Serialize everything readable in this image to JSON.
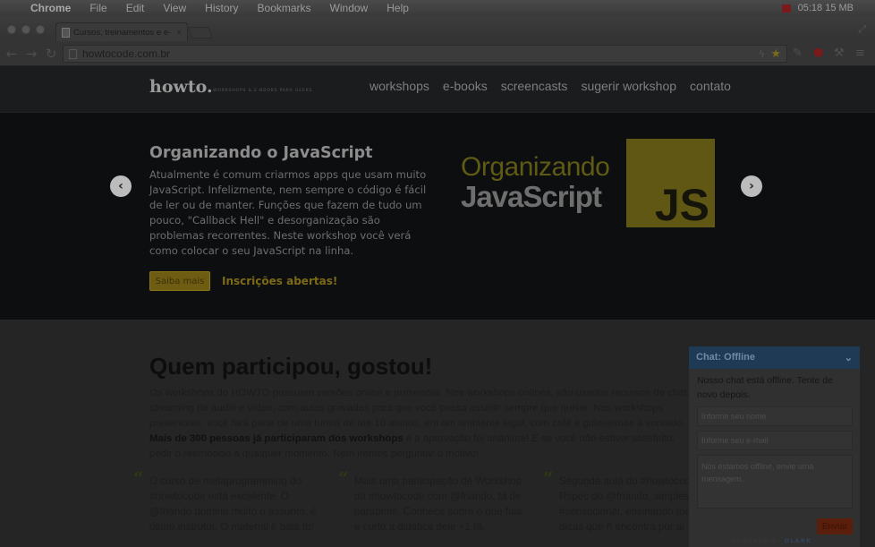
{
  "menubar": {
    "app": "Chrome",
    "items": [
      "File",
      "Edit",
      "View",
      "History",
      "Bookmarks",
      "Window",
      "Help"
    ],
    "status": "05:18  15 MB"
  },
  "browser": {
    "tab_title": "Cursos, treinamentos e e-",
    "tab_close": "×",
    "url": "howtocode.com.br"
  },
  "site": {
    "logo": "howto.",
    "tagline": "WORKSHOPS & E-BOOKS PARA GEEKS",
    "nav": [
      "workshops",
      "e-books",
      "screencasts",
      "sugerir workshop",
      "contato"
    ]
  },
  "hero": {
    "title": "Organizando o JavaScript",
    "description": "Atualmente é comum criarmos apps que usam muito JavaScript. Infelizmente, nem sempre o código é fácil de ler ou de manter. Funções que fazem de tudo um pouco, \"Callback Hell\" e desorganização são problemas recorrentes. Neste workshop você verá como colocar o seu JavaScript na linha.",
    "button": "Saiba mais",
    "status": "Inscrições abertas!",
    "image_line1": "Organizando",
    "image_line2": "JavaScript",
    "image_logo": "JS",
    "prev": "‹",
    "next": "›"
  },
  "section": {
    "title": "Quem participou, gostou!",
    "text_a": "Os workshops do HOWTO possuem versões online e presencial. Nos workshops onlines, são usados recursos de chat, streaming de áudio e vídeo, com aulas gravadas para que você possa assistir sempre que quiser. Nos workshops presenciais, você fará parte de uma turma de até 10 alunos, em um ambiente legal, com café e guloseimas à vontade. ",
    "text_bold": "Mais de 300 pessoas já participaram dos workshops",
    "text_b": " e a aprovação foi unânime! E se você não estiver satisfeito, pedir o reembolso a qualquer momento. Nem iremos perguntar o motivo!"
  },
  "testimonials": [
    "O curso de metaprogramming do #howtocode está excelente. O @fnando domina muito o assunto, é ótimo instrutor. O material é bala tb!",
    "Mais uma participação de Workshop da #howtocode com @fnando, tá de parabéns. Conhece sobre o que fala e curto a didática dele +1 fã.",
    "Segunda aula do #howtocode sobre Rspec do @fnando, simplesmente #sensacional, ensinando todas as dicas que ñ encontra por aí :)"
  ],
  "chat": {
    "header": "Chat: Offline",
    "message": "Nosso chat está offline. Tente de novo depois.",
    "name_placeholder": "Informe seu nome",
    "email_placeholder": "Informe seu e-mail",
    "message_placeholder": "Nós estamos offline, envie uma mensagem.",
    "send": "Enviar",
    "powered_prefix": "POWERED BY ",
    "powered_brand": "OLARK"
  },
  "colors": {
    "accent_yellow": "#c9a82a",
    "chat_blue": "#3a78b5"
  }
}
